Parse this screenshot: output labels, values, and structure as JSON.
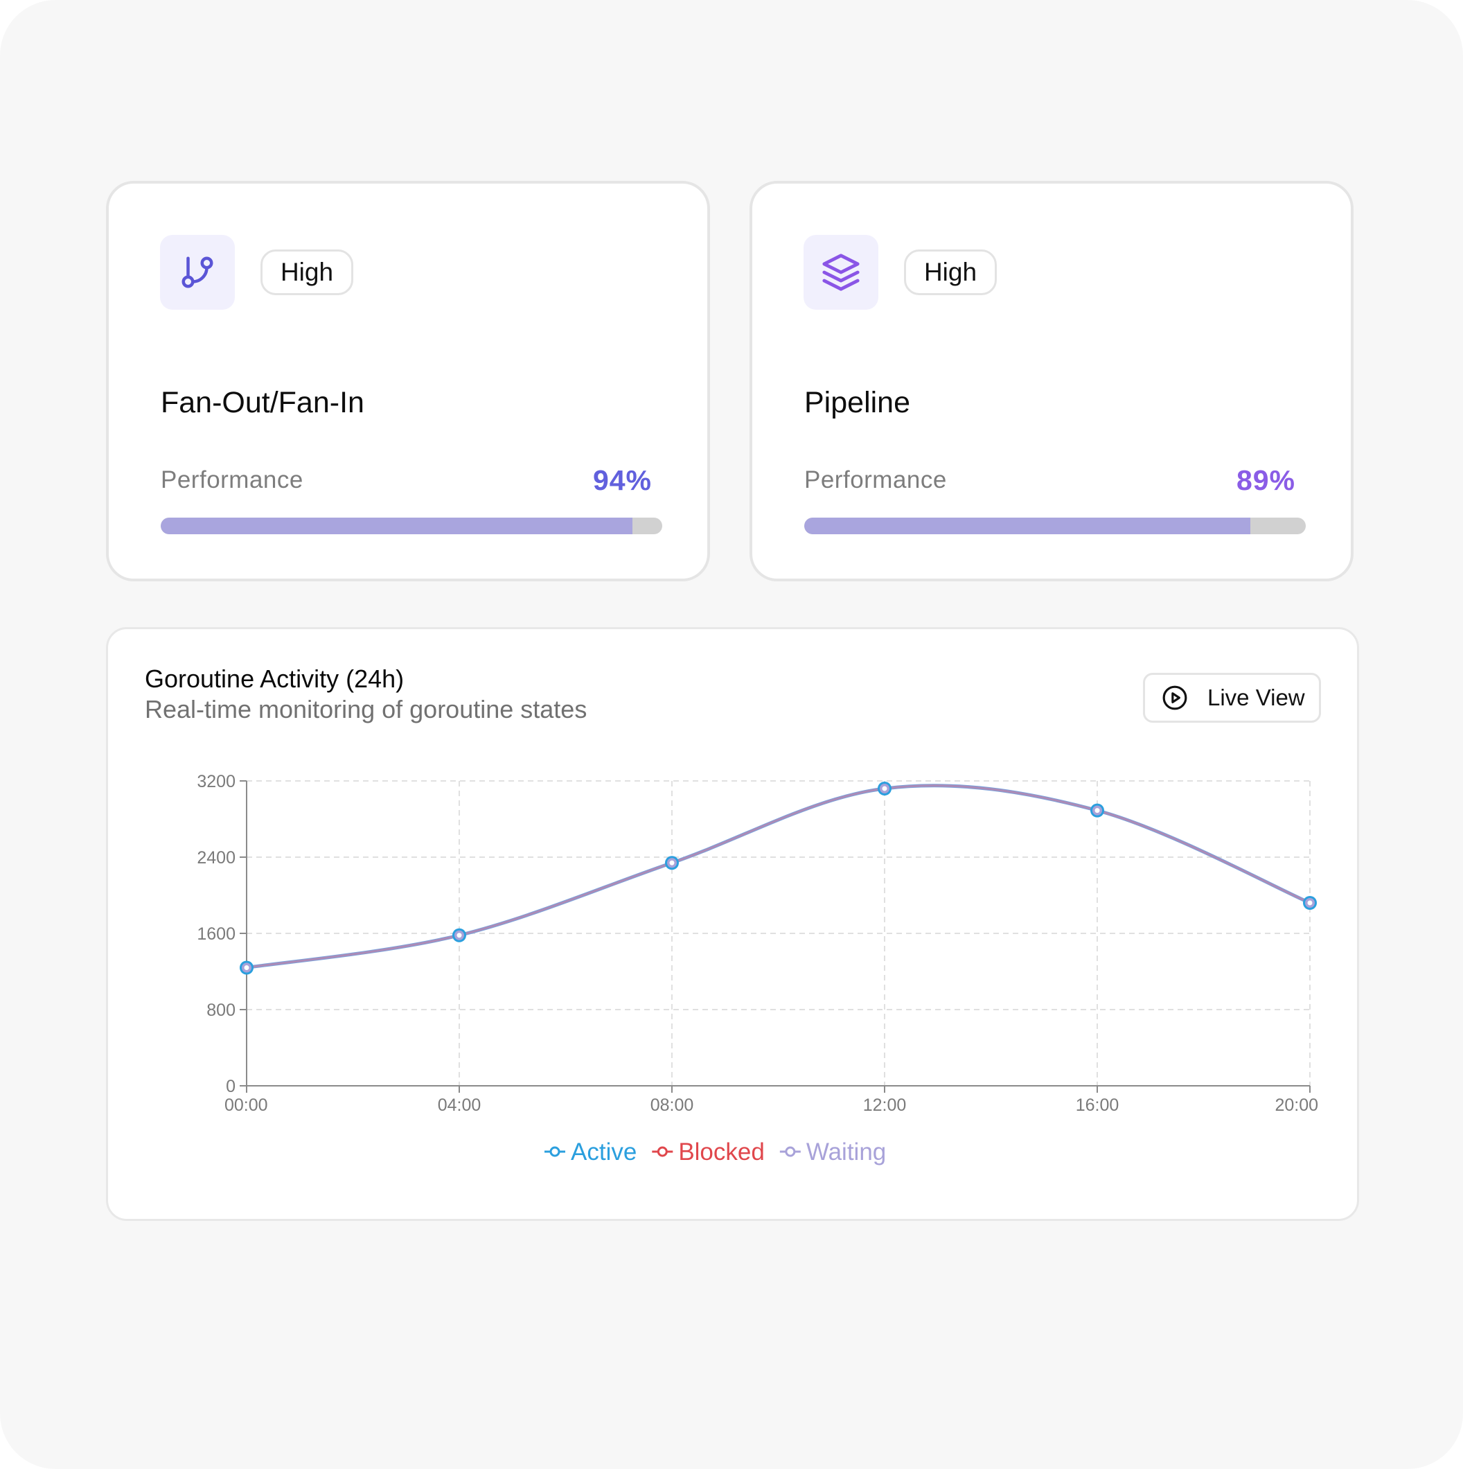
{
  "colors": {
    "active": "#2b9fde",
    "blocked": "#e0474c",
    "waiting": "#a8a2d9",
    "line": "#7aa3dd"
  },
  "cards": [
    {
      "icon": "git-branch-icon",
      "badge": "High",
      "title": "Fan-Out/Fan-In",
      "perf_label": "Performance",
      "perf_text": "94%",
      "perf_value": 94
    },
    {
      "icon": "layers-icon",
      "badge": "High",
      "title": "Pipeline",
      "perf_label": "Performance",
      "perf_text": "89%",
      "perf_value": 89
    }
  ],
  "chart_panel": {
    "title": "Goroutine Activity (24h)",
    "subtitle": "Real-time monitoring of goroutine states",
    "live_button": "Live View",
    "live_icon": "play-circle-icon"
  },
  "chart_data": {
    "type": "line",
    "x": [
      "00:00",
      "04:00",
      "08:00",
      "12:00",
      "16:00",
      "20:00"
    ],
    "y_ticks": [
      0,
      800,
      1600,
      2400,
      3200
    ],
    "ylim": [
      0,
      3200
    ],
    "grid": true,
    "legend_position": "bottom-center",
    "series": [
      {
        "name": "Active",
        "values": [
          1240,
          1580,
          2340,
          3120,
          2890,
          1920
        ]
      },
      {
        "name": "Blocked",
        "values": [
          1240,
          1580,
          2340,
          3120,
          2890,
          1920
        ]
      },
      {
        "name": "Waiting",
        "values": [
          1240,
          1580,
          2340,
          3120,
          2890,
          1920
        ]
      }
    ]
  }
}
